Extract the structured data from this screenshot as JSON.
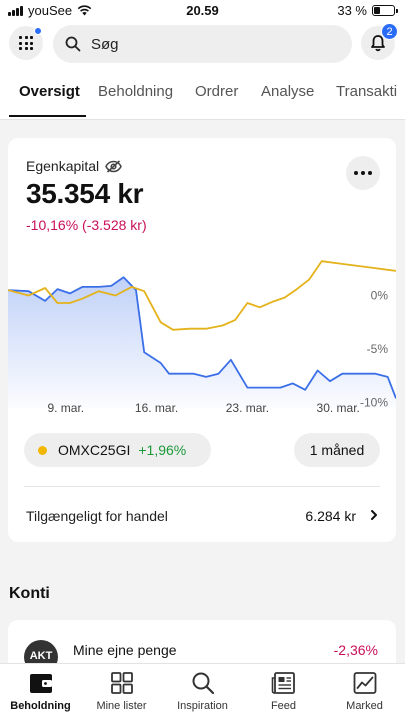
{
  "status_bar": {
    "carrier": "youSee",
    "time": "20.59",
    "battery": "33 %"
  },
  "header": {
    "apps_badge_color": "#2b6cf6",
    "search_placeholder": "Søg",
    "notifications_count": "2",
    "tabs": [
      {
        "label": "Oversigt",
        "active": true
      },
      {
        "label": "Beholdning"
      },
      {
        "label": "Ordrer"
      },
      {
        "label": "Analyse"
      },
      {
        "label": "Transakti"
      }
    ]
  },
  "summary": {
    "label": "Egenkapital",
    "value": "35.354 kr",
    "change": "-10,16% (-3.528 kr)",
    "benchmark_name": "OMXC25GI",
    "benchmark_change": "+1,96%",
    "period": "1 måned",
    "available_label": "Tilgængeligt for handel",
    "available_value": "6.284 kr"
  },
  "chart_data": {
    "type": "line",
    "x_tick_labels": [
      "9. mar.",
      "16. mar.",
      "23. mar.",
      "30. mar."
    ],
    "y_tick_labels": [
      "0%",
      "-5%",
      "-10%"
    ],
    "ylim": [
      -10.5,
      3.5
    ],
    "series": [
      {
        "name": "Egenkapital",
        "color": "#3b6fe8",
        "area_fill": true,
        "points": [
          [
            0,
            0.5
          ],
          [
            5,
            0.4
          ],
          [
            9,
            -0.5
          ],
          [
            12,
            0.6
          ],
          [
            15,
            0.2
          ],
          [
            18,
            0.8
          ],
          [
            22,
            0.8
          ],
          [
            25,
            0.9
          ],
          [
            28,
            1.7
          ],
          [
            31,
            0.5
          ],
          [
            33,
            -5.3
          ],
          [
            37,
            -6.3
          ],
          [
            39,
            -7.3
          ],
          [
            42,
            -7.3
          ],
          [
            45,
            -7.3
          ],
          [
            48,
            -7.6
          ],
          [
            51,
            -7.3
          ],
          [
            54,
            -6.0
          ],
          [
            58,
            -8.6
          ],
          [
            62,
            -8.6
          ],
          [
            66,
            -8.6
          ],
          [
            69,
            -8.2
          ],
          [
            72,
            -8.8
          ],
          [
            75,
            -7.0
          ],
          [
            78,
            -8.0
          ],
          [
            81,
            -7.3
          ],
          [
            85,
            -7.3
          ],
          [
            89,
            -7.3
          ],
          [
            92,
            -7.6
          ],
          [
            94,
            -9.6
          ]
        ]
      },
      {
        "name": "OMXC25GI",
        "color": "#e4b21a",
        "area_fill": false,
        "points": [
          [
            0,
            0.5
          ],
          [
            5,
            0.0
          ],
          [
            9,
            0.7
          ],
          [
            12,
            -0.7
          ],
          [
            15,
            -0.7
          ],
          [
            18,
            -0.3
          ],
          [
            22,
            0.4
          ],
          [
            26,
            0.0
          ],
          [
            30,
            0.8
          ],
          [
            33,
            0.4
          ],
          [
            37,
            -2.5
          ],
          [
            40,
            -3.2
          ],
          [
            44,
            -3.1
          ],
          [
            48,
            -3.1
          ],
          [
            52,
            -2.8
          ],
          [
            55,
            -2.3
          ],
          [
            58,
            -0.7
          ],
          [
            61,
            -1.1
          ],
          [
            64,
            -0.6
          ],
          [
            67,
            -0.2
          ],
          [
            70,
            0.6
          ],
          [
            73,
            1.5
          ],
          [
            76,
            3.2
          ],
          [
            80,
            3.0
          ],
          [
            84,
            2.8
          ],
          [
            88,
            2.6
          ],
          [
            92,
            2.4
          ],
          [
            94,
            2.3
          ]
        ]
      }
    ]
  },
  "konti": {
    "title": "Konti",
    "account_avatar": "AKT",
    "account_name": "Mine ejne penge",
    "account_change": "-2,36%"
  },
  "bottom_nav": [
    {
      "label": "Beholdning",
      "icon": "wallet-icon",
      "active": true
    },
    {
      "label": "Mine lister",
      "icon": "grid-icon"
    },
    {
      "label": "Inspiration",
      "icon": "search-icon"
    },
    {
      "label": "Feed",
      "icon": "newspaper-icon"
    },
    {
      "label": "Marked",
      "icon": "chart-icon"
    }
  ]
}
